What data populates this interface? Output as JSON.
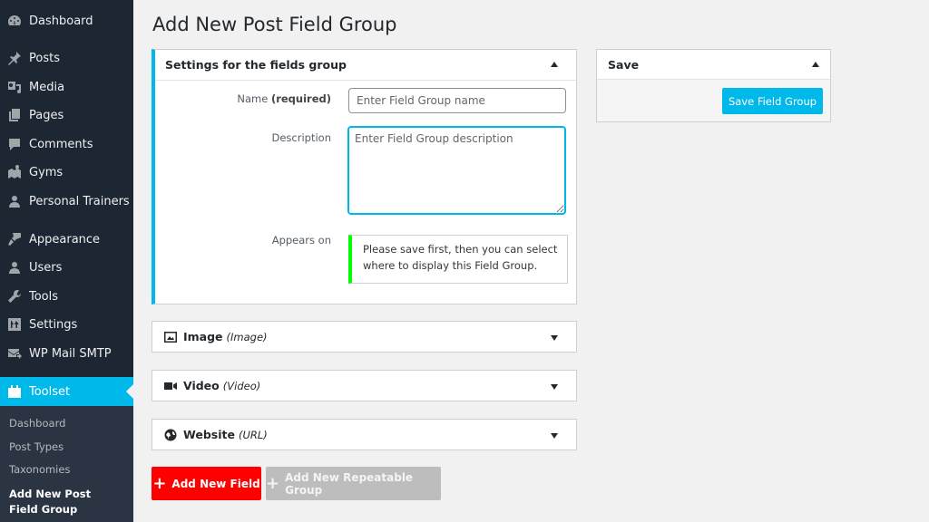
{
  "page": {
    "title": "Add New Post Field Group"
  },
  "sidebar": {
    "items": [
      {
        "label": "Dashboard",
        "icon": "dashboard-icon"
      },
      {
        "label": "Posts",
        "icon": "pin-icon"
      },
      {
        "label": "Media",
        "icon": "media-icon"
      },
      {
        "label": "Pages",
        "icon": "pages-icon"
      },
      {
        "label": "Comments",
        "icon": "comment-icon"
      },
      {
        "label": "Gyms",
        "icon": "map-icon"
      },
      {
        "label": "Personal Trainers",
        "icon": "user-icon"
      },
      {
        "label": "Appearance",
        "icon": "paintbrush-icon"
      },
      {
        "label": "Users",
        "icon": "users-icon"
      },
      {
        "label": "Tools",
        "icon": "wrench-icon"
      },
      {
        "label": "Settings",
        "icon": "settings-icon"
      },
      {
        "label": "WP Mail SMTP",
        "icon": "mail-icon"
      },
      {
        "label": "Toolset",
        "icon": "toolset-icon",
        "active": true
      }
    ],
    "submenu": [
      {
        "label": "Dashboard"
      },
      {
        "label": "Post Types"
      },
      {
        "label": "Taxonomies"
      },
      {
        "label": "Add New Post Field Group",
        "current": true
      }
    ]
  },
  "settings_box": {
    "title": "Settings for the fields group",
    "name_label": "Name",
    "name_required": "(required)",
    "name_placeholder": "Enter Field Group name",
    "name_value": "",
    "description_label": "Description",
    "description_placeholder": "Enter Field Group description",
    "description_value": "",
    "appears_on_label": "Appears on",
    "appears_on_notice": "Please save first, then you can select where to display this Field Group."
  },
  "fields": [
    {
      "name": "Image",
      "type": "(Image)",
      "icon": "image-icon"
    },
    {
      "name": "Video",
      "type": "(Video)",
      "icon": "video-icon"
    },
    {
      "name": "Website",
      "type": "(URL)",
      "icon": "globe-icon"
    }
  ],
  "buttons": {
    "add_new_field": "Add New Field",
    "add_repeatable_group": "Add New Repeatable Group"
  },
  "save_box": {
    "title": "Save",
    "save_button": "Save Field Group"
  },
  "colors": {
    "accent": "#00b9eb",
    "add_field": "#ff0000",
    "repeatable_group": "#bdbdbd",
    "notice_border": "#00ff00",
    "sidebar_bg": "#1d2633"
  }
}
